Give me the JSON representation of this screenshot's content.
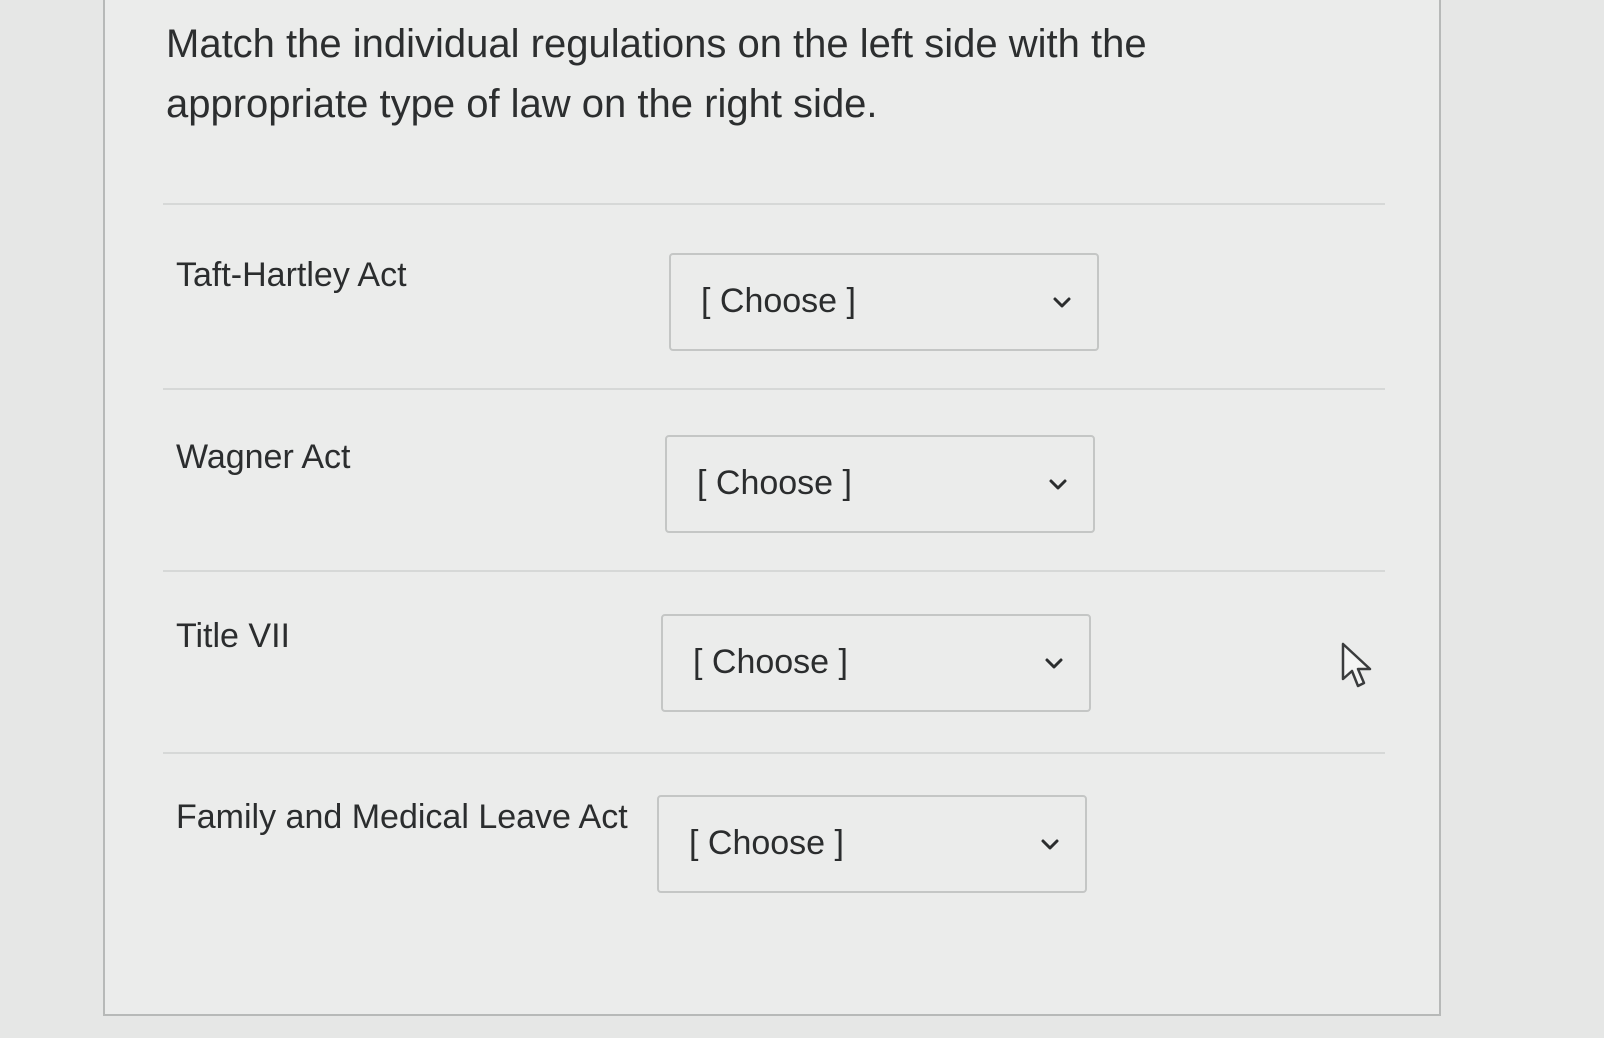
{
  "question": {
    "text": "Match the individual regulations on the left side with the appropriate type of law on the right side."
  },
  "matches": [
    {
      "label": "Taft-Hartley Act",
      "selected": "[ Choose ]"
    },
    {
      "label": "Wagner Act",
      "selected": "[ Choose ]"
    },
    {
      "label": "Title VII",
      "selected": "[ Choose ]"
    },
    {
      "label": "Family and Medical Leave Act",
      "selected": "[ Choose ]"
    }
  ],
  "icons": {
    "dropdown": "chevron-down-icon",
    "pointer": "mouse-pointer-icon"
  },
  "colors": {
    "background": "#e6e7e6",
    "card": "#ebeceb",
    "text": "#2b2d2e",
    "border": "#c4c6c5"
  }
}
